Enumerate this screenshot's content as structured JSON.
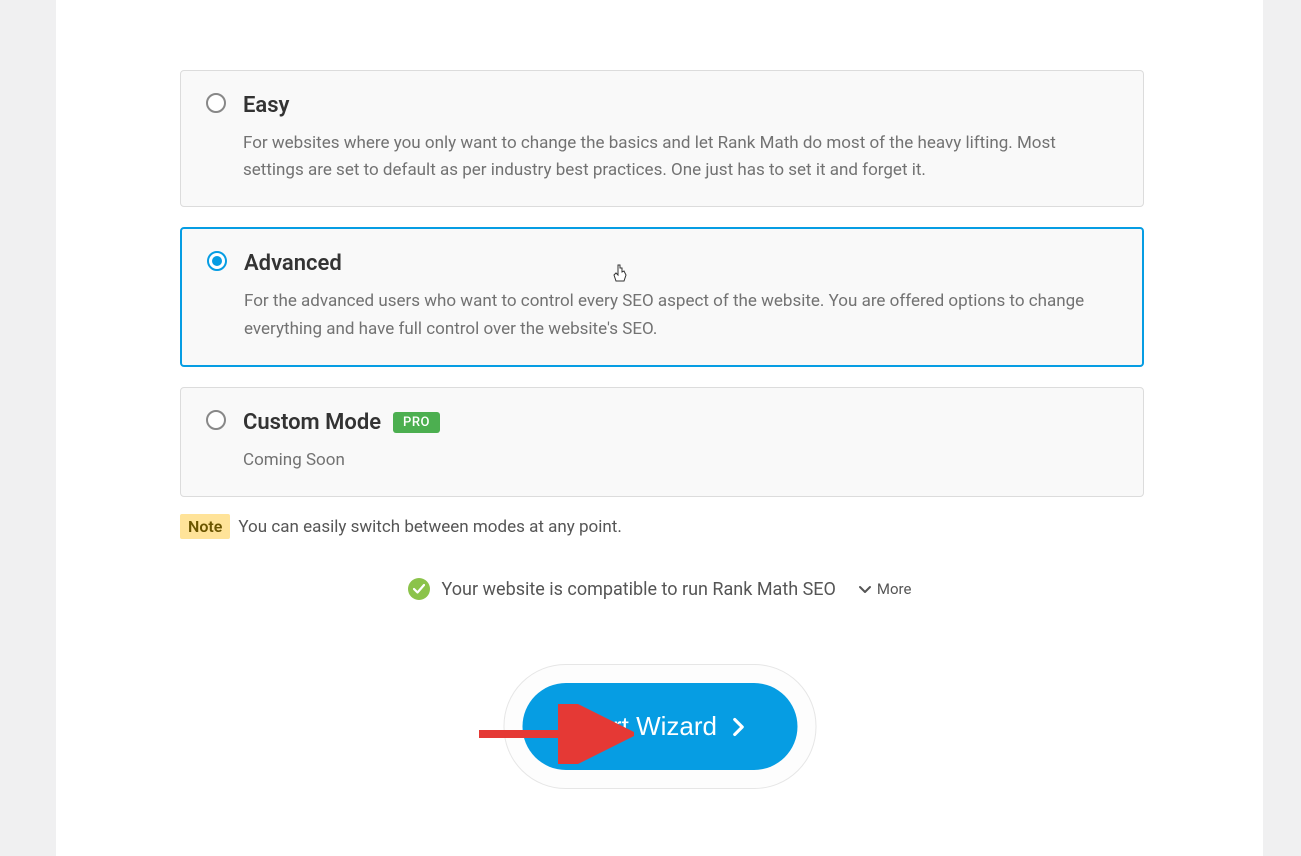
{
  "options": {
    "easy": {
      "title": "Easy",
      "description": "For websites where you only want to change the basics and let Rank Math do most of the heavy lifting. Most settings are set to default as per industry best practices. One just has to set it and forget it.",
      "selected": false
    },
    "advanced": {
      "title": "Advanced",
      "description": "For the advanced users who want to control every SEO aspect of the website. You are offered options to change everything and have full control over the website's SEO.",
      "selected": true
    },
    "custom": {
      "title": "Custom Mode",
      "description": "Coming Soon",
      "badge": "PRO",
      "selected": false
    }
  },
  "note": {
    "label": "Note",
    "text": "You can easily switch between modes at any point."
  },
  "compatibility": {
    "text": "Your website is compatible to run Rank Math SEO",
    "more_label": "More"
  },
  "actions": {
    "start_wizard": "Start Wizard"
  }
}
